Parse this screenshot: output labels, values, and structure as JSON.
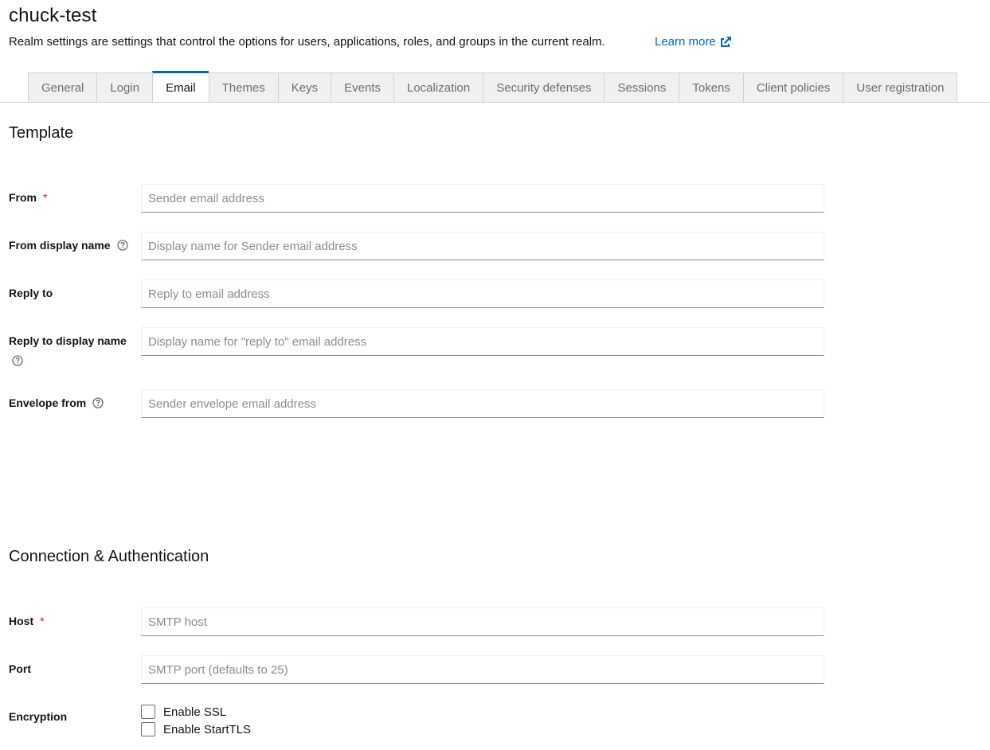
{
  "header": {
    "title": "chuck-test",
    "subtitle": "Realm settings are settings that control the options for users, applications, roles, and groups in the current realm.",
    "learn_more": "Learn more"
  },
  "tabs": [
    {
      "label": "General",
      "active": false
    },
    {
      "label": "Login",
      "active": false
    },
    {
      "label": "Email",
      "active": true
    },
    {
      "label": "Themes",
      "active": false
    },
    {
      "label": "Keys",
      "active": false
    },
    {
      "label": "Events",
      "active": false
    },
    {
      "label": "Localization",
      "active": false
    },
    {
      "label": "Security defenses",
      "active": false
    },
    {
      "label": "Sessions",
      "active": false
    },
    {
      "label": "Tokens",
      "active": false
    },
    {
      "label": "Client policies",
      "active": false
    },
    {
      "label": "User registration",
      "active": false
    }
  ],
  "template_section": {
    "title": "Template",
    "fields": {
      "from": {
        "label": "From",
        "required": "*",
        "value": "",
        "placeholder": "Sender email address"
      },
      "from_display_name": {
        "label": "From display name",
        "value": "",
        "placeholder": "Display name for Sender email address"
      },
      "reply_to": {
        "label": "Reply to",
        "value": "",
        "placeholder": "Reply to email address"
      },
      "reply_to_display_name": {
        "label": "Reply to display name",
        "value": "",
        "placeholder": "Display name for \"reply to\" email address"
      },
      "envelope_from": {
        "label": "Envelope from",
        "value": "",
        "placeholder": "Sender envelope email address"
      }
    }
  },
  "connection_section": {
    "title": "Connection & Authentication",
    "fields": {
      "host": {
        "label": "Host",
        "required": "*",
        "value": "",
        "placeholder": "SMTP host"
      },
      "port": {
        "label": "Port",
        "value": "",
        "placeholder": "SMTP port (defaults to 25)"
      },
      "encryption": {
        "label": "Encryption",
        "options": [
          {
            "label": "Enable SSL",
            "checked": false
          },
          {
            "label": "Enable StartTLS",
            "checked": false
          }
        ]
      }
    }
  },
  "colors": {
    "link": "#0066cc",
    "active_tab_border": "#0066cc",
    "required": "#c9190b",
    "tab_background": "#f0f0f0"
  },
  "icons": {
    "learn_more": "external-link-icon",
    "help": "help-circle-icon"
  }
}
